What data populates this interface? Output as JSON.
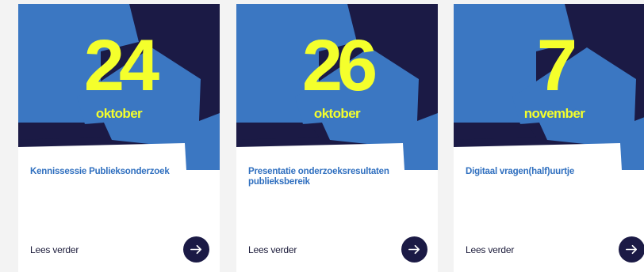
{
  "colors": {
    "navy": "#1b1a45",
    "blue": "#3b77c2",
    "accent_yellow": "#f4ff2c",
    "title_blue": "#2f6fbf"
  },
  "cards": [
    {
      "day": "24",
      "month": "oktober",
      "title": "Kennissessie Publieksonderzoek",
      "more_label": "Lees verder",
      "more_icon": "arrow-right-icon"
    },
    {
      "day": "26",
      "month": "oktober",
      "title": "Presentatie onderzoeksresultaten publieksbereik",
      "more_label": "Lees verder",
      "more_icon": "arrow-right-icon"
    },
    {
      "day": "7",
      "month": "november",
      "title": "Digitaal vragen(half)uurtje",
      "more_label": "Lees verder",
      "more_icon": "arrow-right-icon"
    }
  ]
}
